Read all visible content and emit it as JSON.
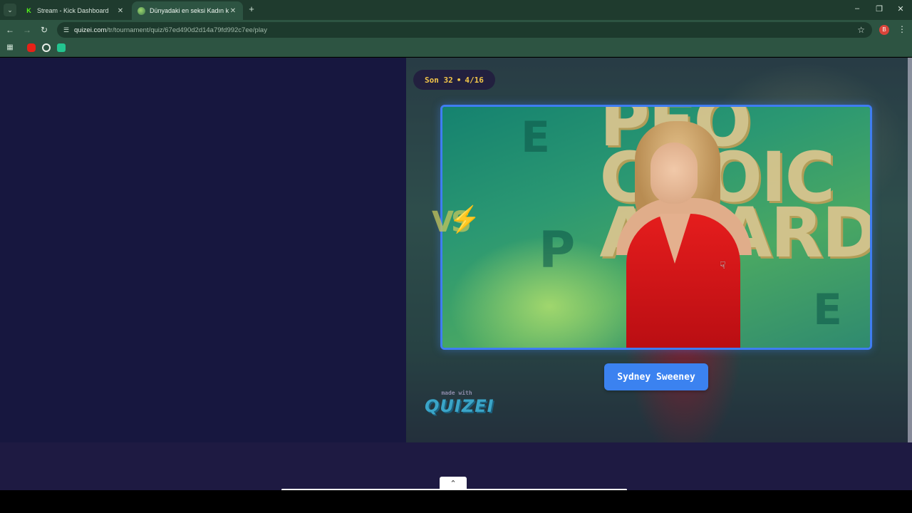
{
  "browser": {
    "tabs": [
      {
        "title": "Stream - Kick Dashboard",
        "favicon": "kick-icon",
        "active": false
      },
      {
        "title": "Dünyadaki en seksi Kadın kim -",
        "favicon": "quizei-icon",
        "active": true
      }
    ],
    "url_host": "quizei.com",
    "url_path": "/tr/tournament/quiz/67ed490d2d14a79fd992c7ee/play",
    "profile_initial": "B",
    "bookmarks": [
      "apps-icon",
      "youtube-icon",
      "chatgpt-icon",
      "extension-icon"
    ]
  },
  "quiz": {
    "round_label": "Son 32",
    "progress_text": "4/16",
    "vs_text": "VS",
    "candidate_name": "Sydney Sweeney",
    "photo_text": [
      "PEO",
      "CHOIC",
      "AWARD"
    ],
    "made_with": "made with",
    "brand": "QUIZEI"
  }
}
